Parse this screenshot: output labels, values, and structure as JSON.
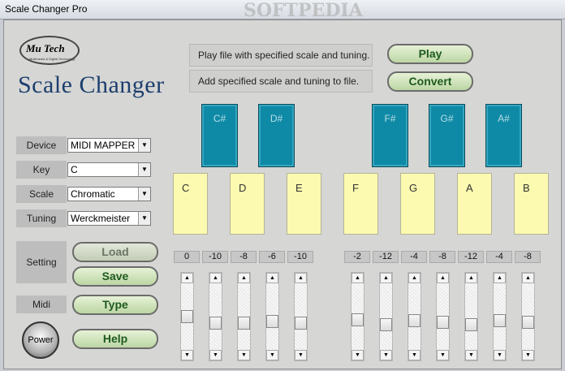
{
  "window": {
    "title": "Scale Changer Pro"
  },
  "logo": {
    "text": "Mu Tech",
    "sub": "Multimedia & Digital Technology"
  },
  "app_title": "Scale Changer",
  "watermark": "SOFTPEDIA",
  "info": {
    "play_text": "Play file with specified scale and tuning.",
    "convert_text": "Add specified scale and tuning to file."
  },
  "buttons": {
    "play": "Play",
    "convert": "Convert",
    "load": "Load",
    "save": "Save",
    "type": "Type",
    "help": "Help",
    "power": "Power"
  },
  "labels": {
    "device": "Device",
    "key": "Key",
    "scale": "Scale",
    "tuning": "Tuning",
    "setting": "Setting",
    "midi": "Midi"
  },
  "selects": {
    "device": "MIDI MAPPER",
    "key": "C",
    "scale": "Chromatic",
    "tuning": "Werckmeister"
  },
  "black_keys": [
    "C#",
    "D#",
    "F#",
    "G#",
    "A#"
  ],
  "white_keys": [
    "C",
    "D",
    "E",
    "F",
    "G",
    "A",
    "B"
  ],
  "values": [
    "0",
    "-10",
    "-8",
    "-6",
    "-10",
    "-2",
    "-12",
    "-4",
    "-8",
    "-12",
    "-4",
    "-8"
  ],
  "colors": {
    "accent": "#1c3f6e",
    "black_key": "#0f8aa6",
    "white_key": "#fbfab0",
    "button_text": "#1e5a1e"
  }
}
